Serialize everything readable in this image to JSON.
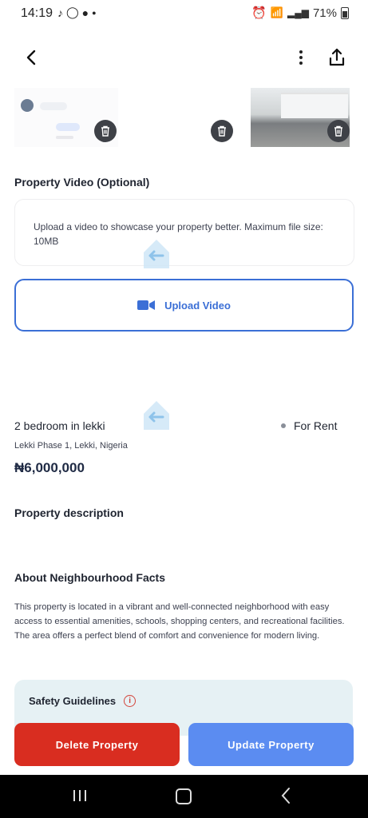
{
  "status_bar": {
    "time": "14:19",
    "app_icons": [
      "tiktok-icon",
      "whatsapp-icon",
      "chat-icon"
    ],
    "battery": "71%"
  },
  "nav": {
    "back_icon": "chevron-left-icon",
    "more_icon": "more-vertical-icon",
    "share_icon": "share-icon"
  },
  "video_section": {
    "title": "Property Video (Optional)",
    "info": "Upload a video to showcase your property better. Maximum file size: 10MB",
    "upload_label": "Upload Video"
  },
  "property": {
    "name": "2 bedroom in lekki",
    "status": "For Rent",
    "location": "Lekki Phase 1, Lekki, Nigeria",
    "price": "₦6,000,000"
  },
  "description": {
    "title": "Property description"
  },
  "neighbourhood": {
    "title": "About Neighbourhood Facts",
    "text": "This property is located in a vibrant and well-connected neighborhood with easy access to essential amenities, schools, shopping centers, and recreational facilities. The area offers a perfect blend of comfort and convenience for modern living."
  },
  "safety": {
    "title": "Safety Guidelines"
  },
  "actions": {
    "delete_label": "Delete Property",
    "update_label": "Update Property"
  },
  "colors": {
    "accent": "#3b6fd6",
    "danger": "#d92d20",
    "primary_button": "#5b8cf1",
    "safety_bg": "#e6f1f4"
  }
}
